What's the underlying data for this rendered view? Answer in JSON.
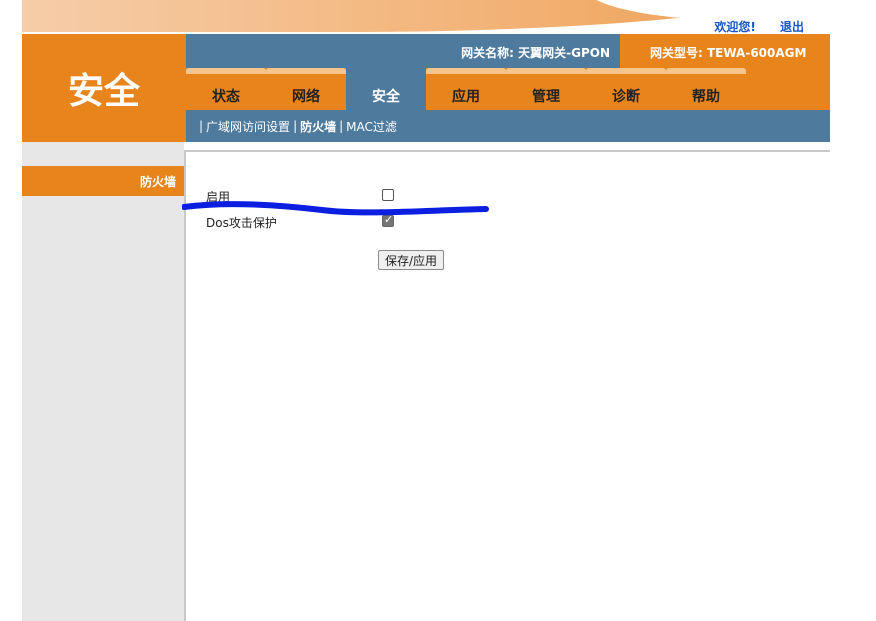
{
  "header": {
    "welcome": "欢迎您!",
    "logout": "退出",
    "gateway_name": "网关名称: 天翼网关-GPON",
    "gateway_model": "网关型号: TEWA-600AGM",
    "section_title": "安全"
  },
  "tabs": [
    {
      "label": "状态"
    },
    {
      "label": "网络"
    },
    {
      "label": "安全",
      "active": true
    },
    {
      "label": "应用"
    },
    {
      "label": "管理"
    },
    {
      "label": "诊断"
    },
    {
      "label": "帮助"
    }
  ],
  "subnav": [
    {
      "label": "广域网访问设置"
    },
    {
      "label": "防火墙",
      "active": true
    },
    {
      "label": "MAC过滤"
    }
  ],
  "sidebar": {
    "items": [
      {
        "label": "防火墙"
      }
    ]
  },
  "form": {
    "enable_label": "启用",
    "enable_checked": false,
    "dos_label": "Dos攻击保护",
    "dos_checked": true,
    "save_label": "保存/应用"
  },
  "colors": {
    "orange": "#e8841c",
    "steel_blue": "#4e7a9e",
    "annotation_blue": "#0a1fe0"
  }
}
